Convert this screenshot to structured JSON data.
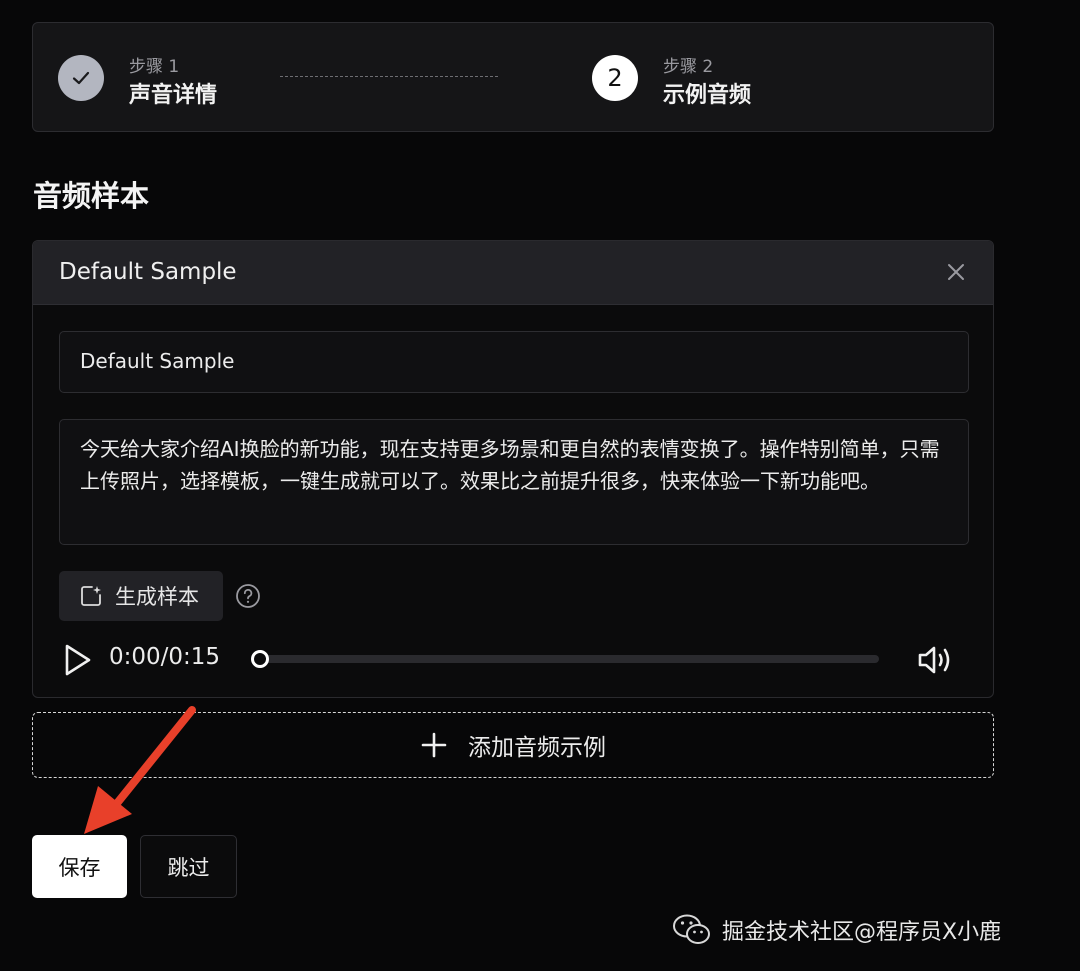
{
  "stepper": {
    "step1": {
      "label": "步骤 1",
      "title": "声音详情",
      "icon": "check-icon"
    },
    "step2": {
      "number": "2",
      "label": "步骤 2",
      "title": "示例音频"
    }
  },
  "section_title": "音频样本",
  "sample_card": {
    "title": "Default Sample",
    "close_icon": "close-icon",
    "name_value": "Default Sample",
    "text_value": "今天给大家介绍AI换脸的新功能，现在支持更多场景和更自然的表情变换了。操作特别简单，只需上传照片，选择模板，一键生成就可以了。效果比之前提升很多，快来体验一下新功能吧。",
    "generate_label": "生成样本",
    "player": {
      "time": "0:00/0:15",
      "progress": 0
    }
  },
  "add_example_label": "添加音频示例",
  "buttons": {
    "save": "保存",
    "skip": "跳过"
  },
  "watermark": "掘金技术社区@程序员X小鹿",
  "colors": {
    "background": "#070708",
    "annotation_arrow": "#e8402a"
  }
}
